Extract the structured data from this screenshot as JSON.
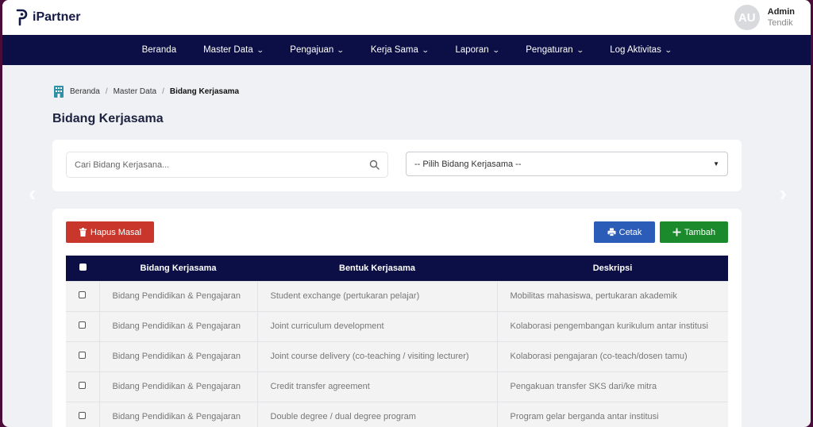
{
  "brand": {
    "name": "iPartner"
  },
  "user": {
    "initials": "AU",
    "name": "Admin",
    "role": "Tendik"
  },
  "nav": [
    {
      "label": "Beranda",
      "dropdown": false
    },
    {
      "label": "Master Data",
      "dropdown": true
    },
    {
      "label": "Pengajuan",
      "dropdown": true
    },
    {
      "label": "Kerja Sama",
      "dropdown": true
    },
    {
      "label": "Laporan",
      "dropdown": true
    },
    {
      "label": "Pengaturan",
      "dropdown": true
    },
    {
      "label": "Log Aktivitas",
      "dropdown": true
    }
  ],
  "breadcrumb": {
    "home": "Beranda",
    "parent": "Master Data",
    "current": "Bidang Kerjasama"
  },
  "page_title": "Bidang Kerjasama",
  "filters": {
    "search_placeholder": "Cari Bidang Kerjasana...",
    "select_value": "-- Pilih Bidang Kerjasama --"
  },
  "actions": {
    "delete_label": "Hapus Masal",
    "print_label": "Cetak",
    "add_label": "Tambah"
  },
  "table": {
    "headers": [
      "Bidang Kerjasama",
      "Bentuk Kerjasama",
      "Deskripsi"
    ],
    "rows": [
      [
        "Bidang Pendidikan & Pengajaran",
        "Student exchange (pertukaran pelajar)",
        "Mobilitas mahasiswa, pertukaran akademik"
      ],
      [
        "Bidang Pendidikan & Pengajaran",
        "Joint curriculum development",
        "Kolaborasi pengembangan kurikulum antar institusi"
      ],
      [
        "Bidang Pendidikan & Pengajaran",
        "Joint course delivery (co-teaching / visiting lecturer)",
        "Kolaborasi pengajaran (co-teach/dosen tamu)"
      ],
      [
        "Bidang Pendidikan & Pengajaran",
        "Credit transfer agreement",
        "Pengakuan transfer SKS dari/ke mitra"
      ],
      [
        "Bidang Pendidikan & Pengajaran",
        "Double degree / dual degree program",
        "Program gelar berganda antar institusi"
      ]
    ]
  },
  "colors": {
    "navy": "#0c0f45",
    "delete": "#c9362b",
    "print": "#2b5cb8",
    "add": "#1a8a2c"
  }
}
